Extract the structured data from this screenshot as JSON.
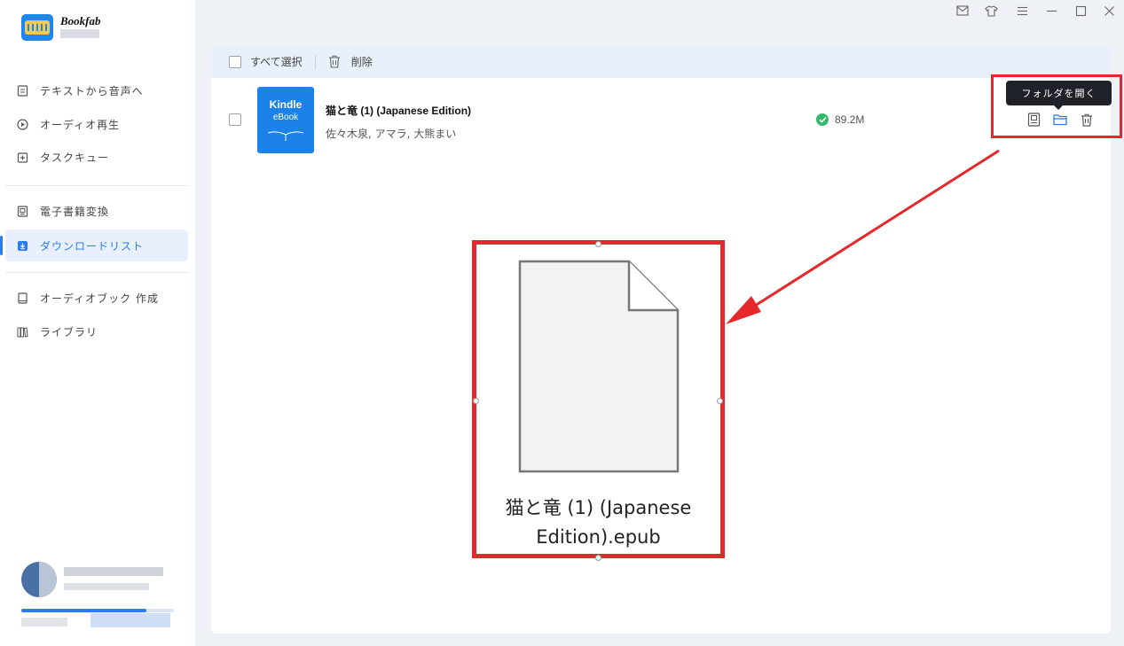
{
  "app": {
    "brand": "Bookfab"
  },
  "sidebar": {
    "items": [
      {
        "label": "テキストから音声へ",
        "icon": "document-icon"
      },
      {
        "label": "オーディオ再生",
        "icon": "play-circle-icon"
      },
      {
        "label": "タスクキュー",
        "icon": "add-task-icon"
      },
      {
        "label": "電子書籍変換",
        "icon": "ebook-convert-icon"
      },
      {
        "label": "ダウンロードリスト",
        "icon": "download-icon",
        "active": true
      },
      {
        "label": "オーディオブック 作成",
        "icon": "audiobook-icon"
      },
      {
        "label": "ライブラリ",
        "icon": "library-icon"
      }
    ]
  },
  "titlebar": {
    "icons": [
      "mail-icon",
      "shirt-icon",
      "menu-icon",
      "minimize-icon",
      "maximize-icon",
      "close-icon"
    ]
  },
  "toolbar": {
    "select_all_label": "すべて選択",
    "delete_label": "削除"
  },
  "download_list": {
    "rows": [
      {
        "cover_line1": "Kindle",
        "cover_line2": "eBook",
        "title": "猫と竜 (1) (Japanese Edition)",
        "author": "佐々木泉, アマラ, 大熊まい",
        "size": "89.2M",
        "status": "completed"
      }
    ]
  },
  "tooltip": {
    "text": "フォルダを開く"
  },
  "file_preview": {
    "file_name_line1": "猫と竜 (1) (Japanese",
    "file_name_line2": "Edition).epub"
  },
  "colors": {
    "accent": "#2a7cf0",
    "highlight": "#e5282b",
    "success": "#34b86a",
    "cover": "#1a82e8"
  }
}
